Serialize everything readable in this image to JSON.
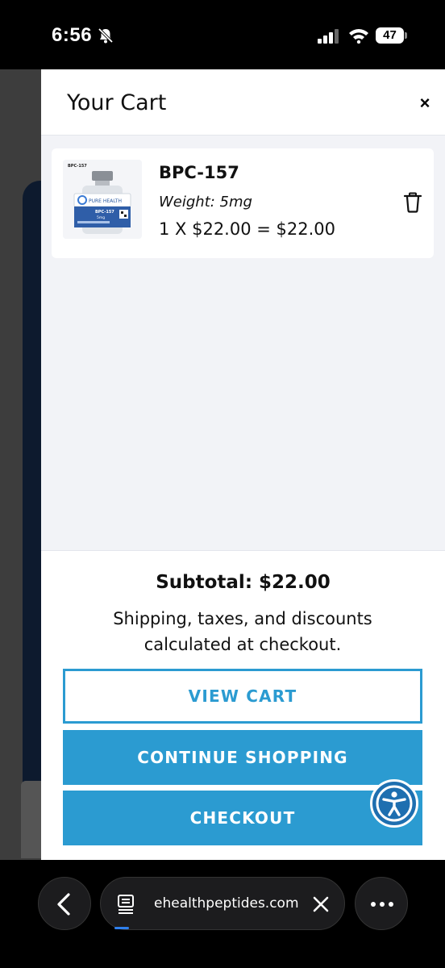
{
  "status_bar": {
    "time": "6:56",
    "battery": "47"
  },
  "cart": {
    "title": "Your Cart",
    "close_label": "×",
    "items": [
      {
        "name": "BPC-157",
        "variant": "Weight: 5mg",
        "price_line": "1 X $22.00 = $22.00",
        "image": {
          "label_top": "BPC-157",
          "brand": "PURE HEALTH",
          "vial_label": "BPC-157",
          "vial_dose": "5mg"
        }
      }
    ],
    "subtotal": "Subtotal: $22.00",
    "shipping_note": "Shipping, taxes, and discounts calculated at checkout.",
    "buttons": {
      "view_cart": "VIEW CART",
      "continue_shopping": "CONTINUE SHOPPING",
      "checkout": "CHECKOUT"
    }
  },
  "browser": {
    "url": "ehealthpeptides.com"
  },
  "colors": {
    "accent": "#2b9bd1",
    "accessibility": "#1e6fb0"
  }
}
